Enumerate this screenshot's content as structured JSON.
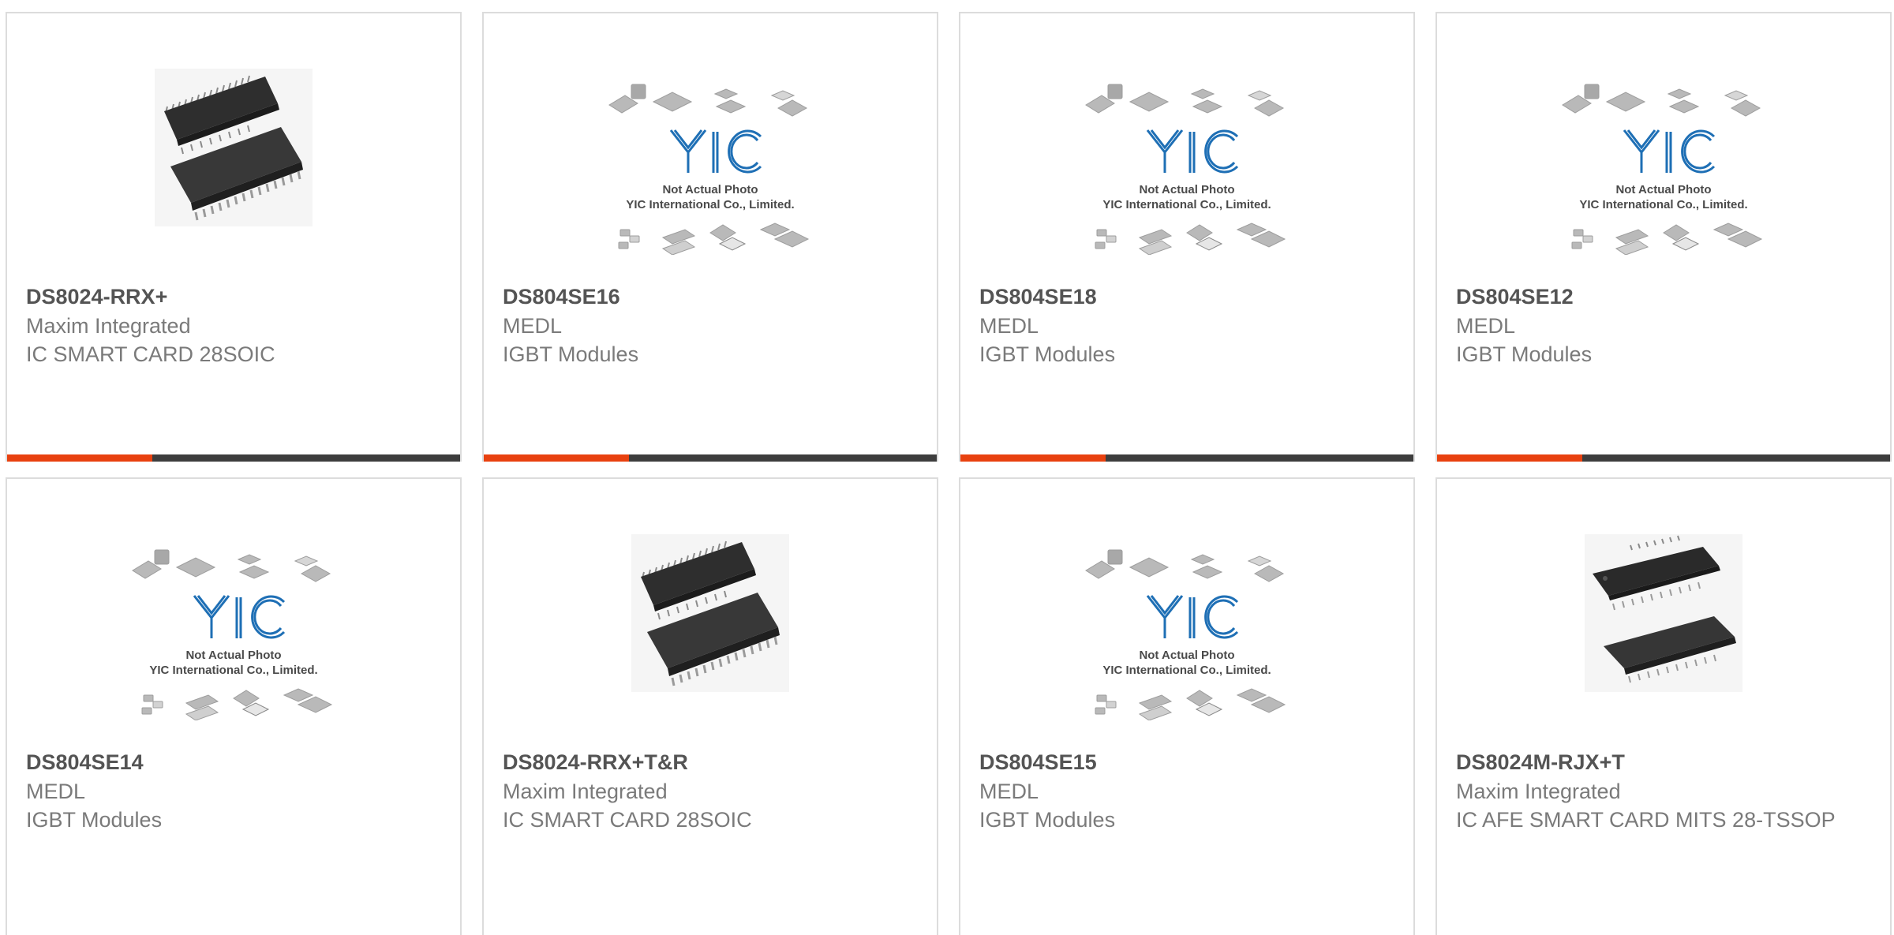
{
  "colors": {
    "accent": "#e8410f",
    "bar_dark": "#3d3d3d",
    "title": "#545454",
    "text": "#7a7a7a",
    "border": "#dcdcdc",
    "logo_blue": "#1e6fb5"
  },
  "placeholder_caption": {
    "line1": "Not Actual Photo",
    "line2": "YIC International Co., Limited.",
    "logo_text": "YIC"
  },
  "products": [
    {
      "part_number": "DS8024-RRX+",
      "manufacturer": "Maxim Integrated",
      "description": "IC SMART CARD 28SOIC",
      "image": "soic-28-photo"
    },
    {
      "part_number": "DS804SE16",
      "manufacturer": "MEDL",
      "description": "IGBT Modules",
      "image": "placeholder"
    },
    {
      "part_number": "DS804SE18",
      "manufacturer": "MEDL",
      "description": "IGBT Modules",
      "image": "placeholder"
    },
    {
      "part_number": "DS804SE12",
      "manufacturer": "MEDL",
      "description": "IGBT Modules",
      "image": "placeholder"
    },
    {
      "part_number": "DS804SE14",
      "manufacturer": "MEDL",
      "description": "IGBT Modules",
      "image": "placeholder"
    },
    {
      "part_number": "DS8024-RRX+T&R",
      "manufacturer": "Maxim Integrated",
      "description": "IC SMART CARD 28SOIC",
      "image": "soic-28-photo"
    },
    {
      "part_number": "DS804SE15",
      "manufacturer": "MEDL",
      "description": "IGBT Modules",
      "image": "placeholder"
    },
    {
      "part_number": "DS8024M-RJX+T",
      "manufacturer": "Maxim Integrated",
      "description": "IC AFE SMART CARD MITS 28-TSSOP",
      "image": "tssop-28-photo"
    }
  ]
}
